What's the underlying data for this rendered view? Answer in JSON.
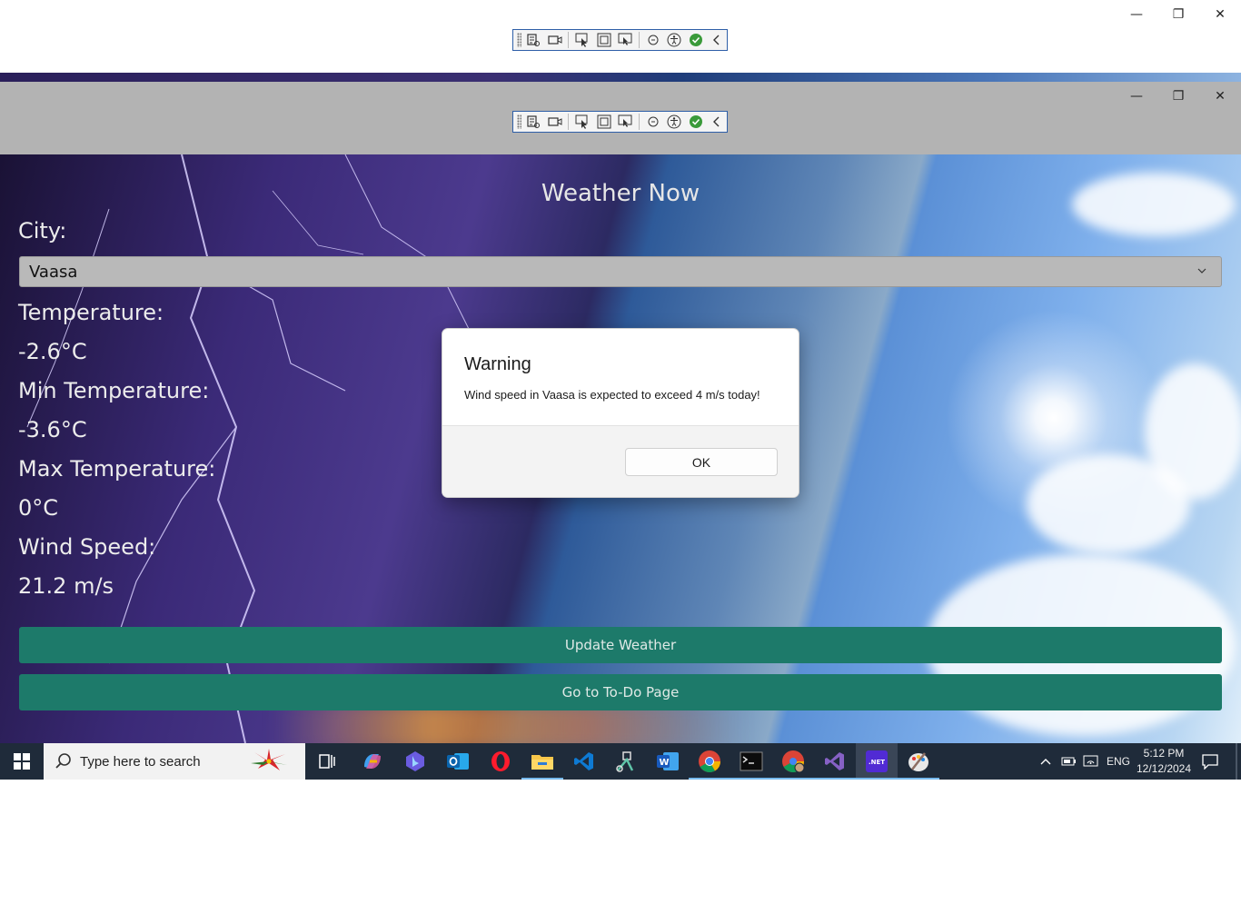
{
  "outer_window": {
    "controls": {
      "minimize": "—",
      "maximize": "❐",
      "close": "✕"
    }
  },
  "inner_window": {
    "controls": {
      "minimize": "—",
      "maximize": "❐",
      "close": "✕"
    }
  },
  "debug_toolbar": {
    "tools": [
      "live-visual-tree-icon",
      "record-icon",
      "select-element-icon",
      "display-layout-adorners-icon",
      "track-focus-icon",
      "binding-failures-icon",
      "accessibility-checker-icon",
      "xaml-hot-reload-ok-icon",
      "collapse-chevron-icon"
    ]
  },
  "app": {
    "title": "Weather Now",
    "city_label": "City:",
    "city_value": "Vaasa",
    "temperature_label": "Temperature:",
    "temperature_value": "-2.6°C",
    "min_temperature_label": "Min Temperature:",
    "min_temperature_value": "-3.6°C",
    "max_temperature_label": "Max Temperature:",
    "max_temperature_value": "0°C",
    "wind_speed_label": "Wind Speed:",
    "wind_speed_value": "21.2 m/s",
    "update_button": "Update Weather",
    "todo_button": "Go to To-Do Page"
  },
  "dialog": {
    "title": "Warning",
    "message": "Wind speed in Vaasa is expected to exceed 4 m/s today!",
    "ok_button": "OK"
  },
  "taskbar": {
    "search_placeholder": "Type here to search",
    "apps": [
      "task-view-icon",
      "copilot-icon",
      "bing-icon",
      "outlook-icon",
      "opera-icon",
      "file-explorer-icon",
      "vscode-icon",
      "snipping-tool-icon",
      "word-icon",
      "chrome-icon",
      "terminal-icon",
      "chrome-profile-icon",
      "visual-studio-icon",
      "dotnet-icon",
      "paint-icon"
    ],
    "language": "ENG",
    "time": "5:12 PM",
    "date": "12/12/2024"
  },
  "colors": {
    "accent_button": "#1d7a6a",
    "taskbar": "#1f2b3a",
    "inner_titlebar": "#b3b3b3"
  }
}
